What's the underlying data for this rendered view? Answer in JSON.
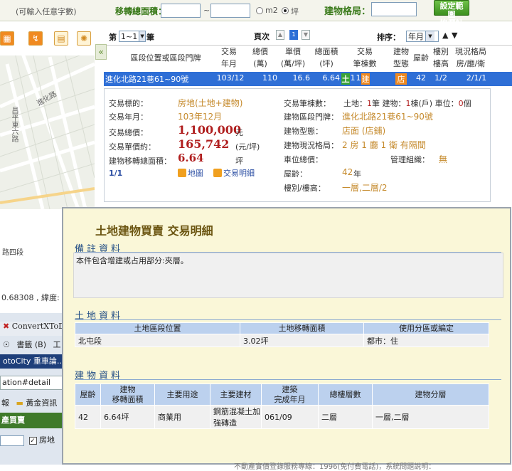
{
  "topbar": {
    "hint": "(可輸入任意字數)",
    "area_label": "移轉總面積：",
    "area_sep": "~",
    "unit_m2": "m2",
    "unit_ping": "坪",
    "layout_label": "建物格局：",
    "calc_button": "設定範圍\n均價計算"
  },
  "pager": {
    "page_label": "第",
    "page_select": "1~1",
    "page_suffix": "筆",
    "page_no_label": "頁次",
    "current_page": "1",
    "sort_label": "排序：",
    "sort_select": "年月",
    "sort_asc": "▲",
    "sort_desc": "▼"
  },
  "table_headers": [
    {
      "line1": "區段位置或區段門牌",
      "line2": ""
    },
    {
      "line1": "交易",
      "line2": "年月"
    },
    {
      "line1": "總價",
      "line2": "(萬)"
    },
    {
      "line1": "單價",
      "line2": "(萬/坪)"
    },
    {
      "line1": "總面積",
      "line2": "(坪)"
    },
    {
      "line1": "交易",
      "line2": "筆棟數"
    },
    {
      "line1": "建物",
      "line2": "型態"
    },
    {
      "line1": "屋齡",
      "line2": ""
    },
    {
      "line1": "樓別",
      "line2": "樓高"
    },
    {
      "line1": "現況格局",
      "line2": "房/廳/衛"
    }
  ],
  "selected_row": {
    "address": "進化北路21巷61~90號",
    "date": "103/12",
    "total": "110",
    "unit_price": "16.6",
    "area": "6.64",
    "land_badge": "土",
    "count_land": "1",
    "count_build": "1",
    "build_badge": "建",
    "type_badge": "店",
    "age": "42",
    "floor": "1/2",
    "layout": "2/1/1"
  },
  "detail": {
    "target_label": "交易標的：",
    "target_value": "房地(土地+建物)",
    "date_label": "交易年月：",
    "date_value": "103年12月",
    "total_label": "交易總價：",
    "total_value": "1,100,000",
    "total_unit": "元",
    "unit_label": "交易單價約：",
    "unit_value": "165,742",
    "unit_unit": "(元/坪)",
    "area_label": "建物移轉總面積：",
    "area_value": "6.64",
    "area_unit": "坪",
    "page_count": "1/1",
    "map_link": "地圖",
    "detail_link": "交易明細",
    "count_label": "交易筆棟數：",
    "count_text_land": "土地：",
    "count_land": "1",
    "count_text_build": "筆 建物：",
    "count_build": "1",
    "count_text_park": "棟(戶) 車位：",
    "count_park": "0",
    "count_text_end": "個",
    "addr_label": "建物區段門牌：",
    "addr_value": "進化北路21巷61~90號",
    "type_label": "建物型態：",
    "type_value": "店面 (店鋪)",
    "layout_label": "建物現況格局：",
    "layout_value": "2 房 1 廳 1 衛 有隔間",
    "park_label": "車位總價：",
    "mgmt_label": "管理組織：",
    "mgmt_value": "無",
    "age_label": "屋齡：",
    "age_value": "42",
    "age_unit": "年",
    "floor_label": "樓別/樓高：",
    "floor_value": "一層,二層",
    "floor_total": "/2"
  },
  "map": {
    "road1": "進化路",
    "road2": "昌平東六路",
    "road3": "路四段",
    "coords": "0.68308 , 緯度: 2"
  },
  "lowerleft": {
    "convert_tab": "ConvertXToDV",
    "menu_bookmarks": "書籤 (B)",
    "menu_tools": "工",
    "motocity": "otoCity 重車論…",
    "url": "ation#detail",
    "toolbar_news": "報",
    "toolbar_gold": "黃金資訊",
    "section": "產買賣",
    "filter_house": "房地"
  },
  "popup": {
    "title": "土地建物買賣 交易明細",
    "note_title": "備註資料",
    "note_text": "本件包含增建或占用部分:夾層。",
    "land_title": "土地資料",
    "land_headers": [
      "土地區段位置",
      "土地移轉面積",
      "使用分區或編定"
    ],
    "land_rows": [
      [
        "北屯段",
        "3.02坪",
        "都市：住"
      ]
    ],
    "build_title": "建物資料",
    "build_headers": [
      "屋齡",
      "建物\n移轉面積",
      "主要用途",
      "主要建材",
      "建築\n完成年月",
      "總樓層數",
      "建物分層"
    ],
    "build_rows": [
      [
        "42",
        "6.64坪",
        "商業用",
        "鋼筋混凝土加強磚造",
        "061/09",
        "二層",
        "一層,二層"
      ]
    ]
  },
  "footer_text": "不動產實價登錄服務專線：1996(免付費電話)，系統問題說明："
}
